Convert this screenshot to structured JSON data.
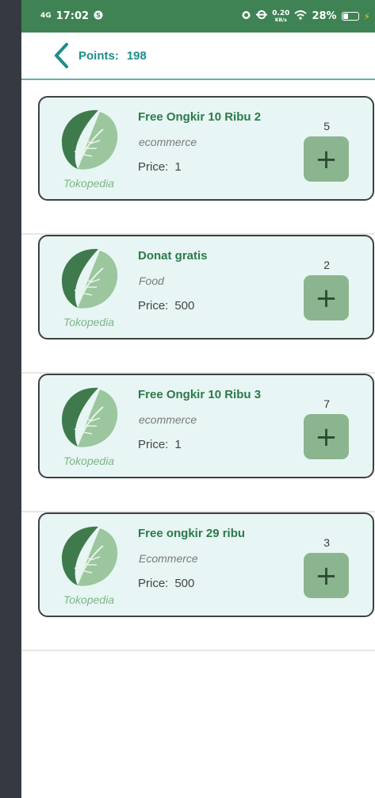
{
  "status_bar": {
    "signal": "4G",
    "time": "17:02",
    "net_speed_value": "0.20",
    "net_speed_unit": "KB/s",
    "battery": "28%"
  },
  "header": {
    "points_label": "Points:",
    "points_value": "198"
  },
  "colors": {
    "status_bar": "#3f8354",
    "accent": "#1b8f8b",
    "card_bg": "#e7f6f4",
    "button_bg": "#8bb58e",
    "title": "#2c7a49"
  },
  "items": [
    {
      "title": "Free Ongkir 10 Ribu 2",
      "category": "ecommerce",
      "price_label": "Price:",
      "price": "1",
      "quantity": "5",
      "brand": "Tokopedia",
      "add_label": "+"
    },
    {
      "title": "Donat gratis",
      "category": "Food",
      "price_label": "Price:",
      "price": "500",
      "quantity": "2",
      "brand": "Tokopedia",
      "add_label": "+"
    },
    {
      "title": "Free Ongkir 10 Ribu 3",
      "category": "ecommerce",
      "price_label": "Price:",
      "price": "1",
      "quantity": "7",
      "brand": "Tokopedia",
      "add_label": "+"
    },
    {
      "title": "Free ongkir 29 ribu",
      "category": "Ecommerce",
      "price_label": "Price:",
      "price": "500",
      "quantity": "3",
      "brand": "Tokopedia",
      "add_label": "+"
    }
  ]
}
